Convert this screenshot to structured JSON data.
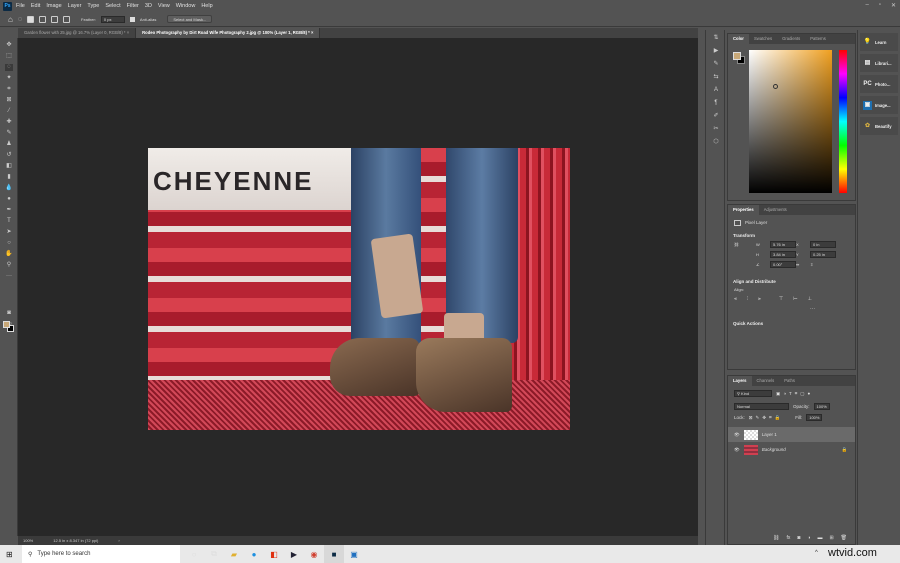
{
  "menubar": {
    "app_logo": "Ps",
    "items": [
      "File",
      "Edit",
      "Image",
      "Layer",
      "Type",
      "Select",
      "Filter",
      "3D",
      "View",
      "Window",
      "Help"
    ]
  },
  "options": {
    "feather_label": "Feather:",
    "feather_value": "0 px",
    "antialias_label": "Anti-alias",
    "select_mask": "Select and Mask..."
  },
  "tabs": [
    {
      "label": "Garden flower with 25.jpg @ 16.7% (Layer 0, RGB/8) *"
    },
    {
      "label": "Rodeo Photography by Dirt Road Wife Photography 2.jpg @ 100% (Layer 1, RGB/8) *"
    }
  ],
  "photo": {
    "sign_text": "CHEYENNE"
  },
  "status": {
    "zoom": "100%",
    "doc_size": "12.5 in x 8.347 in (72 ppi)"
  },
  "color_panel": {
    "tabs": [
      "Color",
      "Swatches",
      "Gradients",
      "Patterns"
    ],
    "fg_color": "#c8a878",
    "bg_color": "#000000",
    "hue_color": "#f0a020"
  },
  "properties": {
    "tabs": [
      "Properties",
      "Adjustments"
    ],
    "layer_type": "Pixel Layer",
    "transform_label": "Transform",
    "w": "5.76 in",
    "x": "0 in",
    "h": "3.84 in",
    "y": "0.25 in",
    "angle": "0.00°",
    "align_label": "Align and Distribute",
    "align_sub": "Align:",
    "quick_actions": "Quick Actions"
  },
  "layers": {
    "tabs": [
      "Layers",
      "Channels",
      "Paths"
    ],
    "kind": "Kind",
    "blend": "Normal",
    "opacity_label": "Opacity:",
    "opacity": "100%",
    "lock_label": "Lock:",
    "fill_label": "Fill:",
    "fill": "100%",
    "items": [
      {
        "name": "Layer 1"
      },
      {
        "name": "Background"
      }
    ]
  },
  "farright": {
    "items": [
      "Learn",
      "Librari...",
      "Photo...",
      "Image...",
      "Beautify"
    ]
  },
  "taskbar": {
    "search_placeholder": "Type here to search",
    "watermark": "wtvid.com"
  }
}
